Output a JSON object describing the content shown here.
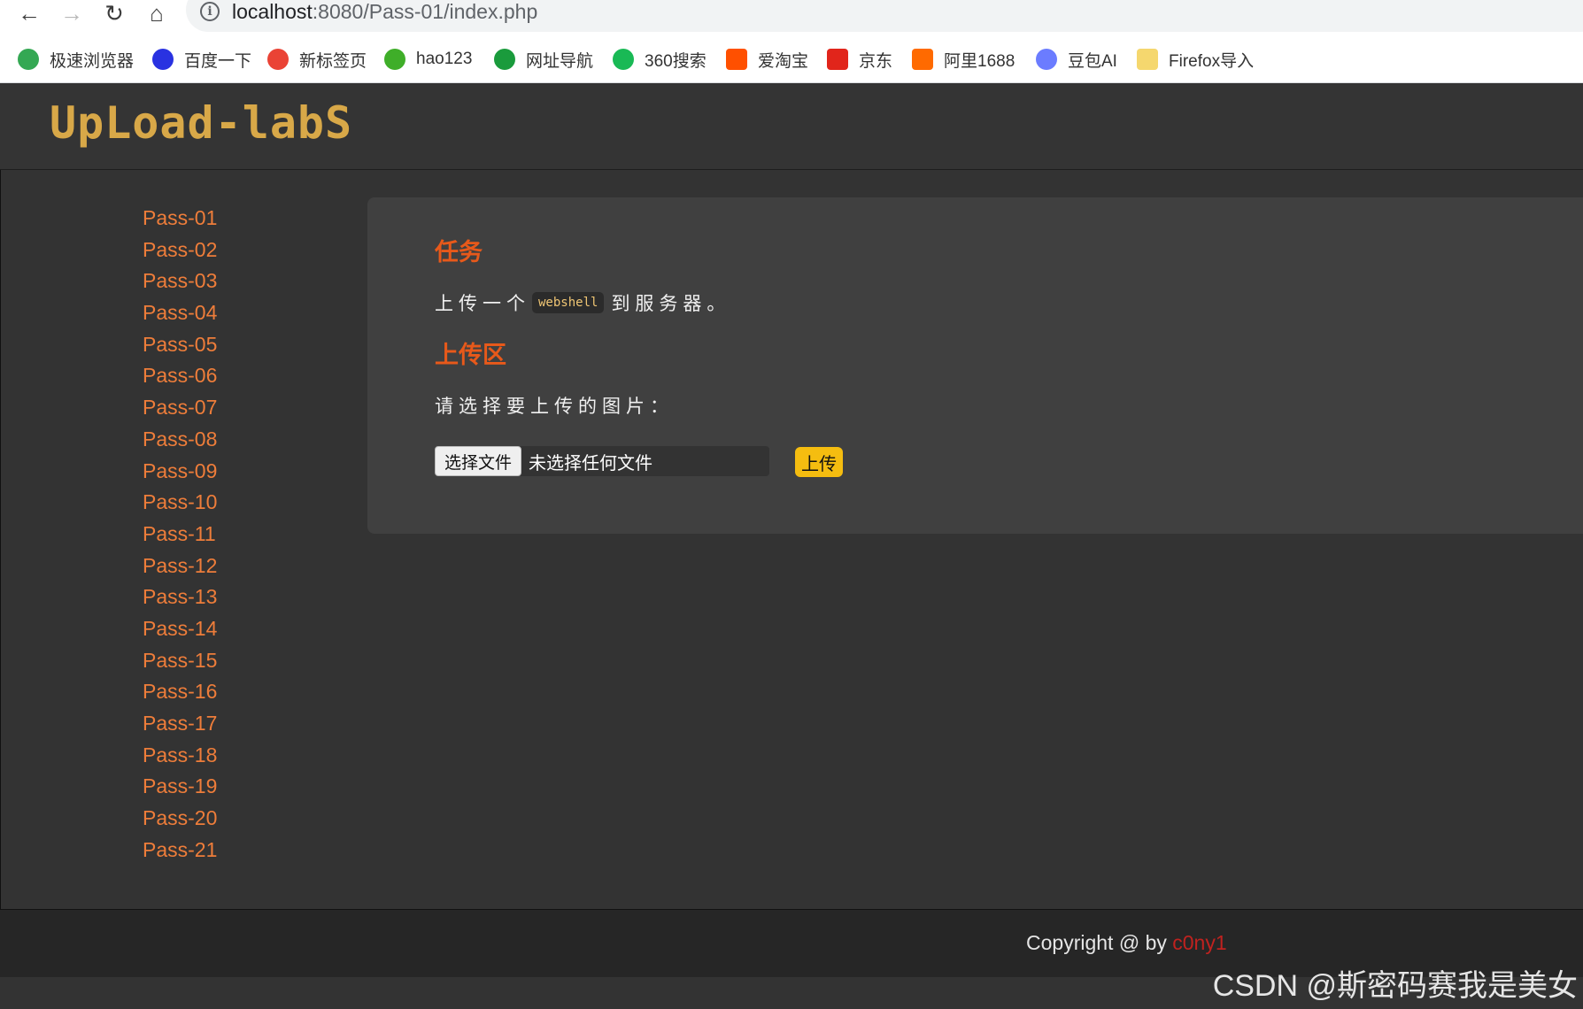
{
  "browser": {
    "url_host": "localhost",
    "url_path": ":8080/Pass-01/index.php",
    "bookmarks": [
      {
        "label": "极速浏览器",
        "icon": "chrome-icon",
        "color": "#34a853"
      },
      {
        "label": "百度一下",
        "icon": "baidu-paw-icon",
        "color": "#2932e1"
      },
      {
        "label": "新标签页",
        "icon": "chrome-icon",
        "color": "#ea4335"
      },
      {
        "label": "hao123",
        "icon": "hao123-icon",
        "color": "#3fae29"
      },
      {
        "label": "网址导航",
        "icon": "2345-icon",
        "color": "#1a9b3c"
      },
      {
        "label": "360搜索",
        "icon": "360-search-icon",
        "color": "#19b955"
      },
      {
        "label": "爱淘宝",
        "icon": "taobao-icon",
        "color": "#ff5000"
      },
      {
        "label": "京东",
        "icon": "jd-icon",
        "color": "#e1251b"
      },
      {
        "label": "阿里1688",
        "icon": "alibaba-1688-icon",
        "color": "#ff6a00"
      },
      {
        "label": "豆包AI",
        "icon": "doubao-avatar-icon",
        "color": "#6b7cff"
      },
      {
        "label": "Firefox导入",
        "icon": "folder-icon",
        "color": "#f5d76e"
      }
    ]
  },
  "header": {
    "logo": "UpLoad-labS"
  },
  "menu": [
    "Pass-01",
    "Pass-02",
    "Pass-03",
    "Pass-04",
    "Pass-05",
    "Pass-06",
    "Pass-07",
    "Pass-08",
    "Pass-09",
    "Pass-10",
    "Pass-11",
    "Pass-12",
    "Pass-13",
    "Pass-14",
    "Pass-15",
    "Pass-16",
    "Pass-17",
    "Pass-18",
    "Pass-19",
    "Pass-20",
    "Pass-21"
  ],
  "task": {
    "title": "任务",
    "text_before": "上传一个",
    "code": "webshell",
    "text_after": "到服务器。"
  },
  "upload": {
    "title": "上传区",
    "prompt": "请选择要上传的图片：",
    "choose_file_label": "选择文件",
    "no_file_text": "未选择任何文件",
    "submit_label": "上传"
  },
  "footer": {
    "copyright": "Copyright @  by ",
    "author": "c0ny1"
  },
  "watermark": "CSDN @斯密码赛我是美女"
}
